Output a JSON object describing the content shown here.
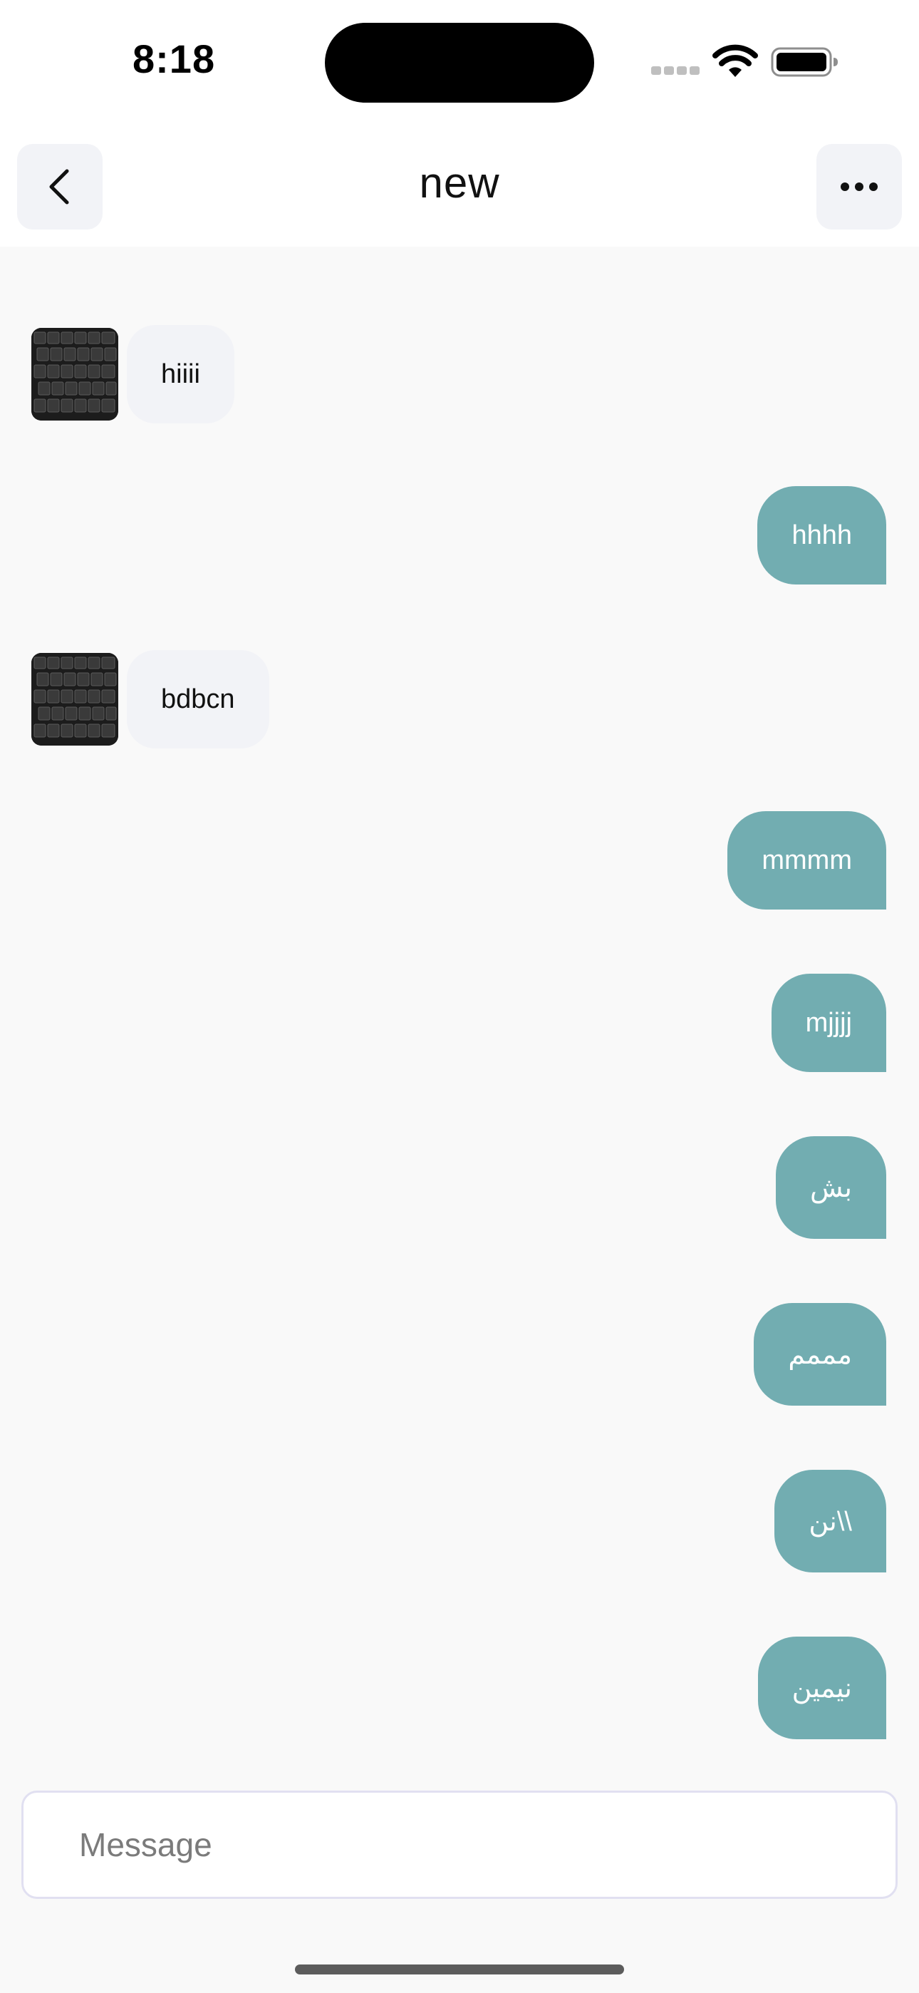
{
  "status_bar": {
    "time": "8:18",
    "icons": [
      "cellular-signal-icon",
      "wifi-icon",
      "battery-icon"
    ]
  },
  "header": {
    "title": "new",
    "back_icon": "chevron-left-icon",
    "more_icon": "ellipsis-icon"
  },
  "messages": [
    {
      "direction": "incoming",
      "text": "hiiii",
      "avatar": "keyboard-photo-avatar"
    },
    {
      "direction": "outgoing",
      "text": "hhhh"
    },
    {
      "direction": "incoming",
      "text": "bdbcn",
      "avatar": "keyboard-photo-avatar"
    },
    {
      "direction": "outgoing",
      "text": "mmmm"
    },
    {
      "direction": "outgoing",
      "text": "mjjjj"
    },
    {
      "direction": "outgoing",
      "text": "بش"
    },
    {
      "direction": "outgoing",
      "text": "مممم"
    },
    {
      "direction": "outgoing",
      "text": "\\\\نن"
    },
    {
      "direction": "outgoing",
      "text": "نيمين"
    }
  ],
  "composer": {
    "placeholder": "Message",
    "value": ""
  },
  "colors": {
    "outgoing_bubble": "#72adb1",
    "incoming_bubble": "#f2f3f7",
    "chat_background": "#f9f9f9",
    "input_border": "#e1e0f1"
  }
}
